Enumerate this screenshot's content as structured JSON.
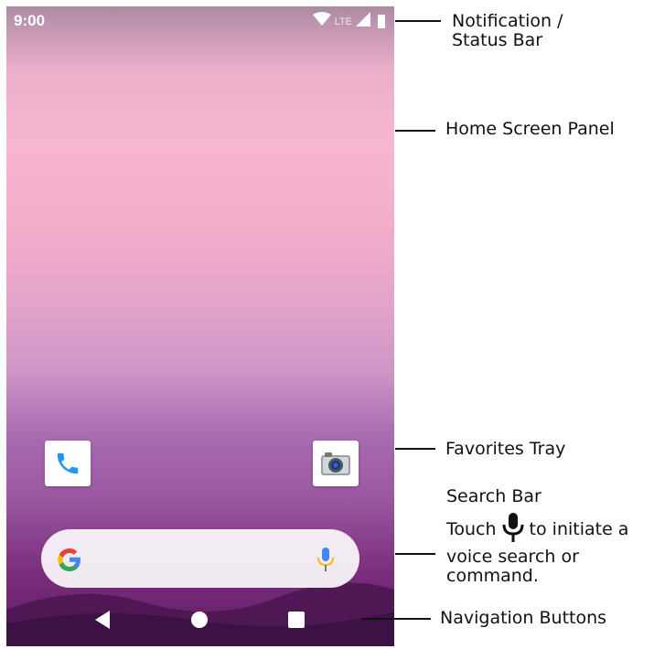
{
  "status_bar": {
    "time": "9:00",
    "network": "LTE",
    "icons": [
      "wifi-icon",
      "signal-icon",
      "battery-icon"
    ]
  },
  "favorites": {
    "apps": [
      {
        "name": "phone",
        "icon": "phone-icon",
        "color": "#2196f3"
      },
      {
        "name": "camera",
        "icon": "camera-icon",
        "color": "#607d8b"
      }
    ]
  },
  "search_bar": {
    "logo": "google-g-icon",
    "mic": "mic-icon"
  },
  "navigation": {
    "buttons": [
      "back-icon",
      "home-icon",
      "recents-icon"
    ]
  },
  "callouts": {
    "status_line1": "Notification /",
    "status_line2": "Status Bar",
    "home_panel": "Home Screen Panel",
    "favorites_tray": "Favorites Tray",
    "search_bar_title": "Search Bar",
    "touch_prefix": "Touch",
    "touch_suffix": "to initiate a",
    "voice_line1": "voice search or",
    "voice_line2": "command.",
    "nav_buttons": "Navigation Buttons"
  }
}
